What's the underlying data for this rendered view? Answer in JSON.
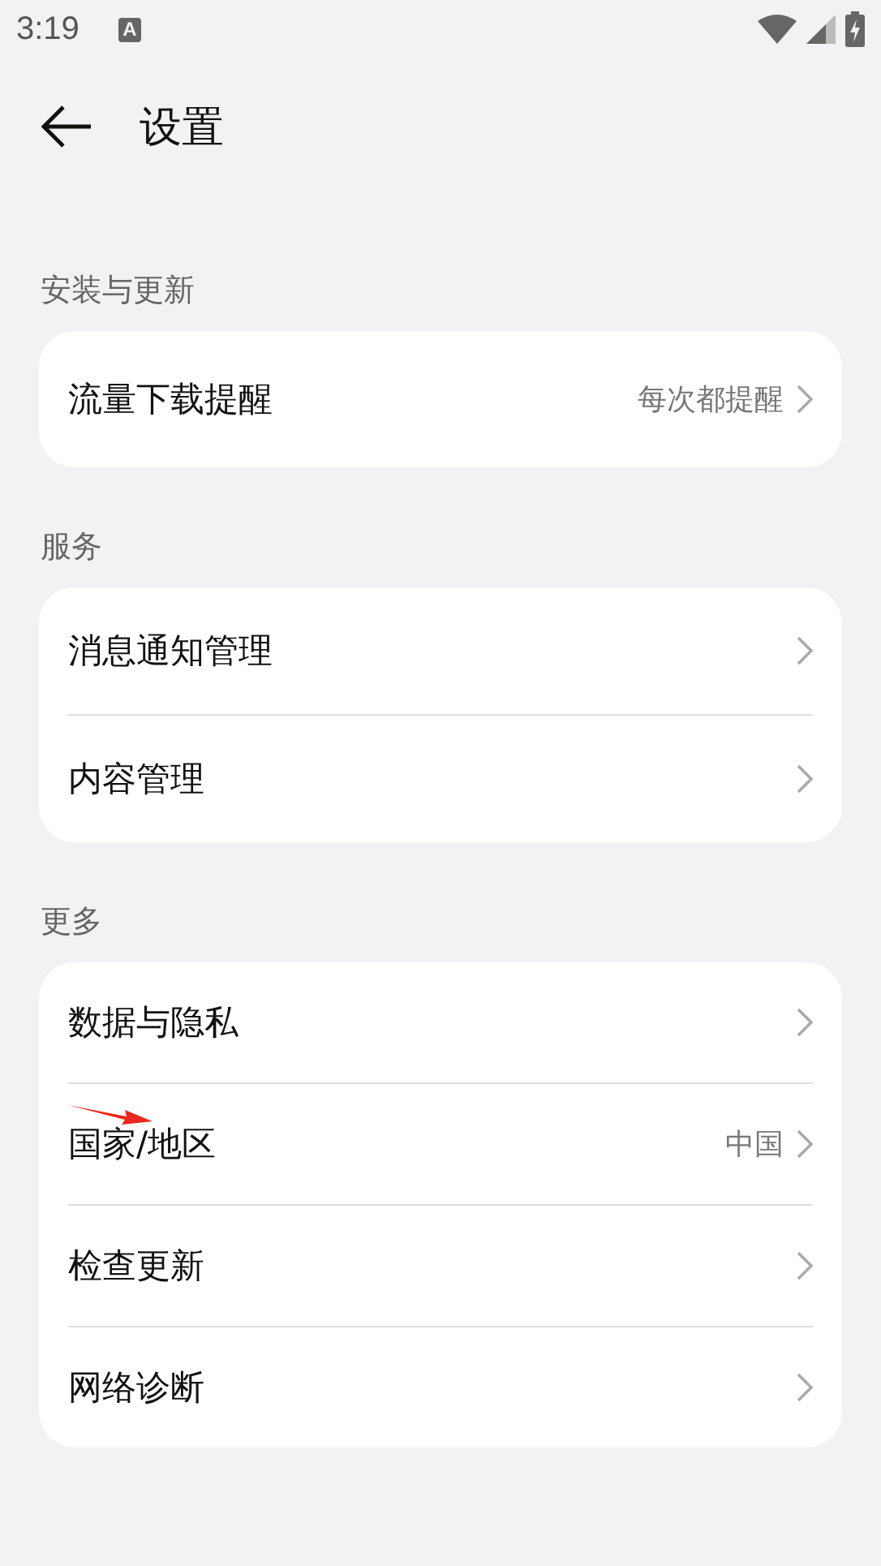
{
  "status_bar": {
    "time": "3:19",
    "notification_icon": "A"
  },
  "header": {
    "title": "设置"
  },
  "sections": [
    {
      "label": "安装与更新",
      "items": [
        {
          "label": "流量下载提醒",
          "value": "每次都提醒",
          "annotated": false
        }
      ]
    },
    {
      "label": "服务",
      "items": [
        {
          "label": "消息通知管理",
          "annotated": false
        },
        {
          "label": "内容管理",
          "annotated": false
        }
      ]
    },
    {
      "label": "更多",
      "items": [
        {
          "label": "数据与隐私",
          "annotated": false
        },
        {
          "label": "国家/地区",
          "value": "中国",
          "annotated": true
        },
        {
          "label": "检查更新",
          "annotated": false
        },
        {
          "label": "网络诊断",
          "annotated": false
        }
      ]
    }
  ]
}
